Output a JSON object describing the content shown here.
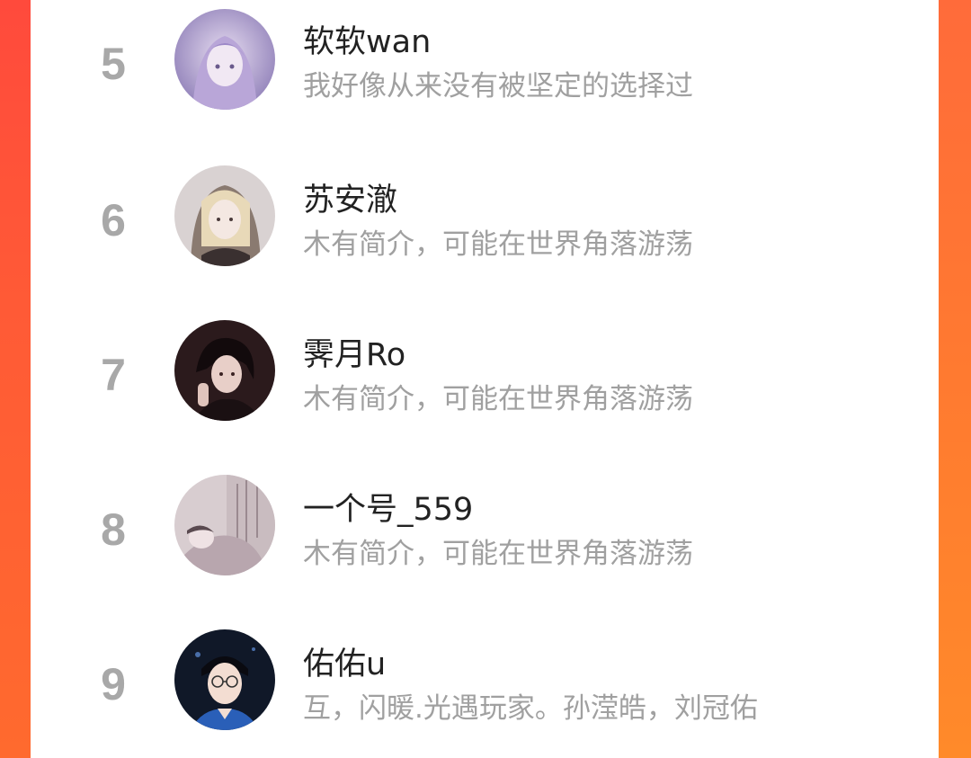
{
  "users": [
    {
      "rank": "5",
      "name": "软软wan",
      "bio": "我好像从来没有被坚定的选择过",
      "avatar": "anime-girl-avatar"
    },
    {
      "rank": "6",
      "name": "苏安澈",
      "bio": "木有简介，可能在世界角落游荡",
      "avatar": "anime-man-avatar"
    },
    {
      "rank": "7",
      "name": "霁月Ro",
      "bio": "木有简介，可能在世界角落游荡",
      "avatar": "dark-haired-man-avatar"
    },
    {
      "rank": "8",
      "name": "一个号_559",
      "bio": "木有简介，可能在世界角落游荡",
      "avatar": "illustration-avatar"
    },
    {
      "rank": "9",
      "name": "佑佑u",
      "bio": "互，闪暖.光遇玩家。孙滢皓，刘冠佑",
      "avatar": "boy-with-glasses-avatar"
    }
  ],
  "colors": {
    "background_accent": "#ff4a3c",
    "rank_gray": "#a8a8a8",
    "name_text": "#222222",
    "bio_text": "#a0a0a0"
  }
}
